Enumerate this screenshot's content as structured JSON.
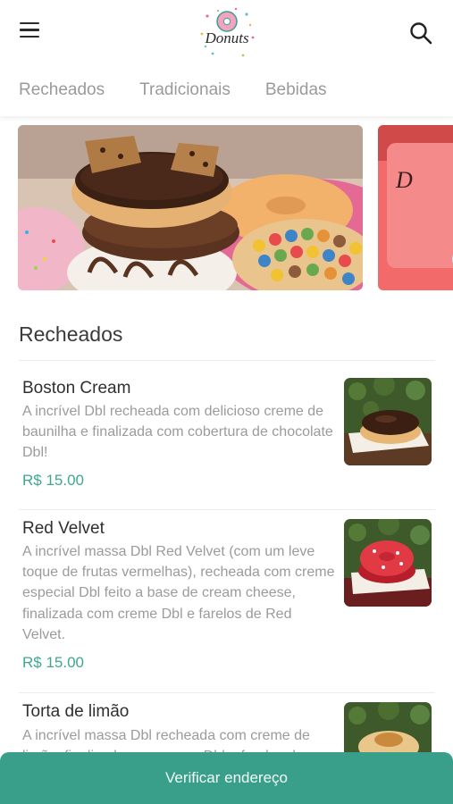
{
  "header": {
    "menu_icon": "hamburger-menu-icon",
    "search_icon": "search-icon",
    "logo_text": "Donuts"
  },
  "tabs": [
    {
      "label": "Recheados"
    },
    {
      "label": "Tradicionais"
    },
    {
      "label": "Bebidas"
    }
  ],
  "section": {
    "title": "Recheados"
  },
  "products": [
    {
      "name": "Boston Cream",
      "description": "A incrível Dbl recheada com delicioso creme de baunilha e finalizada com cobertura de chocolate Dbl!",
      "price": "R$ 15.00"
    },
    {
      "name": "Red Velvet",
      "description": "A incrível massa Dbl Red Velvet (com um leve toque de frutas vermelhas), recheada com creme especial Dbl feito a base de cream cheese, finalizada com creme Dbl e farelos de Red Velvet.",
      "price": "R$ 15.00"
    },
    {
      "name": "Torta de limão",
      "description": "A incrível massa Dbl recheada com creme de limão, finalizada com creme Dbl e farelos de torta.",
      "price": ""
    }
  ],
  "footer": {
    "button_label": "Verificar endereço"
  },
  "colors": {
    "accent": "#3a9f8a",
    "price": "#3da88e"
  }
}
